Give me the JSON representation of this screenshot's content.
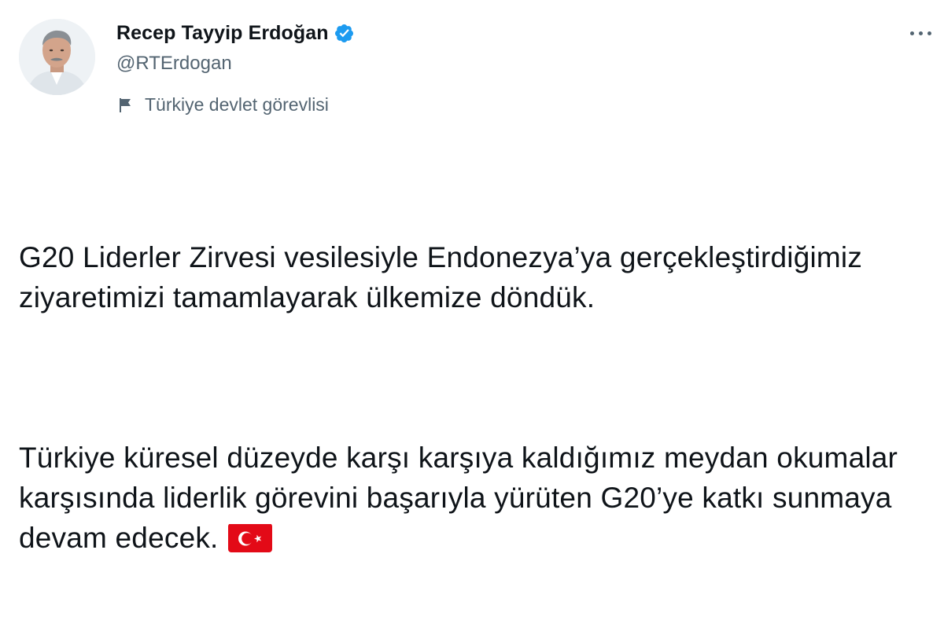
{
  "author": {
    "display_name": "Recep Tayyip Erdoğan",
    "handle": "@RTErdogan",
    "verified": true,
    "account_label": "Türkiye devlet görevlisi",
    "label_icon": "flag-icon",
    "avatar_icon": "avatar"
  },
  "tweet": {
    "paragraph_1": "G20 Liderler Zirvesi vesilesiyle Endonezya’ya gerçekleştirdiğimiz ziyaretimizi tamamlayarak ülkemize döndük.",
    "paragraph_2": "Türkiye küresel düzeyde karşı karşıya kaldığımız meydan okumalar karşısında liderlik görevini başarıyla yürüten G20’ye katkı sunmaya devam edecek.",
    "emoji": "turkey-flag-emoji"
  },
  "colors": {
    "text_primary": "#0f1419",
    "text_secondary": "#536471",
    "verified_blue": "#1d9bf0",
    "flag_red": "#e30a17"
  },
  "actions": {
    "more_icon": "more-horizontal-icon"
  }
}
